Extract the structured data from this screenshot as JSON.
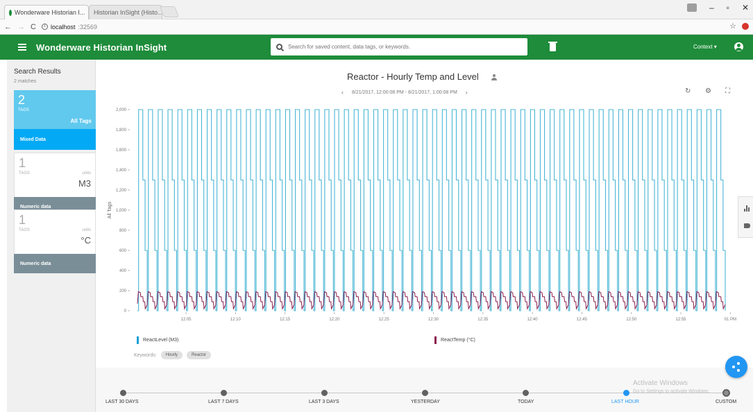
{
  "browser": {
    "tabs": [
      {
        "label": "Wonderware Historian I...",
        "active": true
      },
      {
        "label": "Historian InSight (Histo...",
        "active": false
      }
    ],
    "url": "localhost",
    "url_port": ":32569"
  },
  "header": {
    "title": "Wonderware Historian InSight",
    "search_placeholder": "Search for saved content, data tags, or keywords.",
    "context_label": "Context"
  },
  "sidebar": {
    "title": "Search Results",
    "subtitle": "2 matches",
    "all_tags": {
      "count": "2",
      "label": "TAGS",
      "name": "All Tags",
      "footer": "Mixed Data"
    },
    "cards": [
      {
        "count": "1",
        "label": "TAGS",
        "units_label": "units",
        "unit": "M3",
        "footer": "Numeric data"
      },
      {
        "count": "1",
        "label": "TAGS",
        "units_label": "units",
        "unit": "°C",
        "footer": "Numeric data"
      }
    ]
  },
  "main": {
    "title": "Reactor - Hourly Temp and Level",
    "range": "8/21/2017, 12:00:08 PM - 8/21/2017, 1:00:08 PM",
    "keywords_label": "Keywords:",
    "keywords": [
      "Hourly",
      "Reactor"
    ]
  },
  "chart_data": {
    "type": "line",
    "title": "Reactor - Hourly Temp and Level",
    "ylabel": "All Tags",
    "ylim": [
      0,
      2000
    ],
    "yticks": [
      "2,000",
      "1,800",
      "1,600",
      "1,400",
      "1,200",
      "1,000",
      "800",
      "600",
      "400",
      "200",
      "0"
    ],
    "xticks": [
      "12:05",
      "12:10",
      "12:15",
      "12:20",
      "12:25",
      "12:30",
      "12:35",
      "12:40",
      "12:45",
      "12:50",
      "12:55",
      "01 PM"
    ],
    "x_range": [
      "12:00:08 PM",
      "1:00:08 PM"
    ],
    "series": [
      {
        "name": "ReactLevel (M3)",
        "color": "#49b6d6",
        "pattern": "square wave",
        "cycles": 60,
        "low": 0,
        "high": 2000,
        "values": [
          0,
          2000,
          1300,
          600,
          0,
          2000,
          1300,
          600
        ]
      },
      {
        "name": "ReactTemp (°C)",
        "color": "#8b1c4e",
        "pattern": "periodic",
        "cycles": 60,
        "low": 0,
        "high": 190,
        "values": [
          60,
          190,
          150,
          90,
          20,
          60,
          190,
          150
        ]
      }
    ],
    "legend": "bottom"
  },
  "timeline": {
    "stops": [
      {
        "label": "LAST 30 DAYS",
        "active": false
      },
      {
        "label": "LAST 7 DAYS",
        "active": false
      },
      {
        "label": "LAST 3 DAYS",
        "active": false
      },
      {
        "label": "YESTERDAY",
        "active": false
      },
      {
        "label": "TODAY",
        "active": false
      },
      {
        "label": "LAST HOUR",
        "active": true
      },
      {
        "label": "CUSTOM",
        "active": false
      }
    ]
  },
  "watermark": {
    "line1": "Activate Windows",
    "line2": "Go to Settings to activate Windows."
  }
}
